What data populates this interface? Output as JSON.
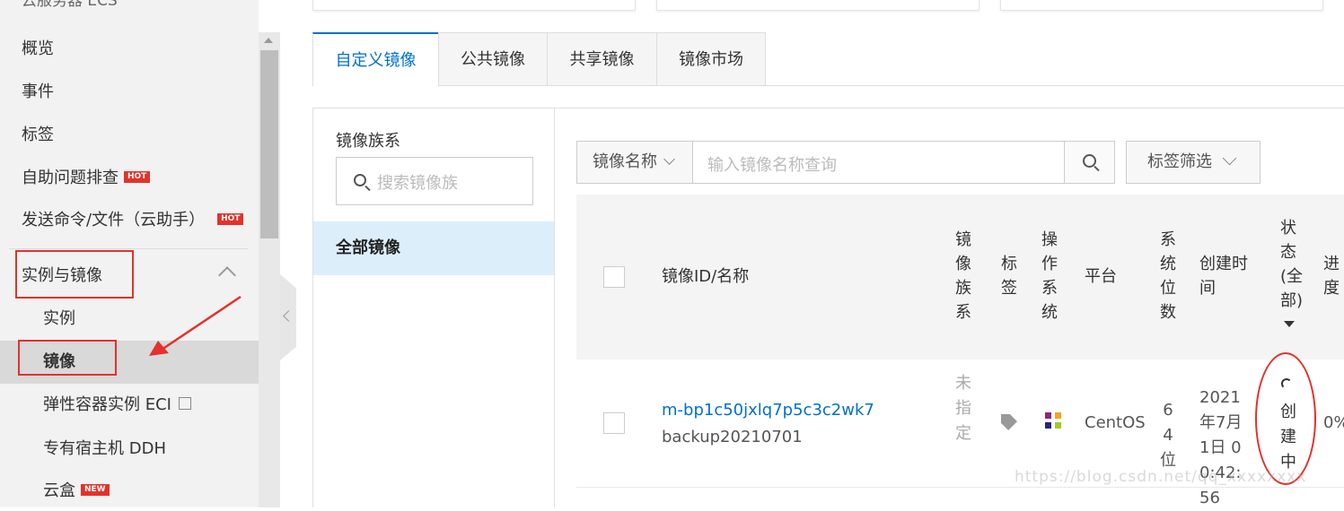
{
  "sidebar": {
    "title": "云服务器 ECS",
    "items": [
      {
        "label": "概览"
      },
      {
        "label": "事件"
      },
      {
        "label": "标签"
      },
      {
        "label": "自助问题排查",
        "badge": "HOT"
      },
      {
        "label": "发送命令/文件（云助手）",
        "badge": "HOT"
      }
    ],
    "group": {
      "label": "实例与镜像",
      "expanded": true
    },
    "sub_items": [
      {
        "label": "实例"
      },
      {
        "label": "镜像",
        "active": true
      },
      {
        "label": "弹性容器实例 ECI",
        "external": true
      },
      {
        "label": "专有宿主机 DDH"
      },
      {
        "label": "云盒",
        "badge": "NEW"
      }
    ]
  },
  "tabs": [
    {
      "label": "自定义镜像",
      "active": true
    },
    {
      "label": "公共镜像"
    },
    {
      "label": "共享镜像"
    },
    {
      "label": "镜像市场"
    }
  ],
  "family": {
    "title": "镜像族系",
    "search_placeholder": "搜索镜像族",
    "all_label": "全部镜像"
  },
  "filter": {
    "select_value": "镜像名称",
    "input_placeholder": "输入镜像名称查询",
    "tag_filter_label": "标签筛选"
  },
  "table": {
    "headers": {
      "id_name": "镜像ID/名称",
      "family": "镜像族系",
      "tags": "标签",
      "os": "操作系统",
      "platform": "平台",
      "bits": "系统位数",
      "created": "创建时间",
      "status": "状态(全部)",
      "progress": "进度"
    },
    "rows": [
      {
        "id": "m-bp1c50jxlq7p5c3c2wk7",
        "name": "backup20210701",
        "family": "未指定",
        "platform": "CentOS",
        "bits": "64位",
        "created": "2021年7月1日 00:42:56",
        "status": "创建中",
        "progress": "0%"
      }
    ]
  },
  "watermark": "https://blog.csdn.net/qq_xxxxxxxx",
  "colors": {
    "accent": "#0070cc",
    "hot_badge": "#e4312b",
    "annotation": "#e4312b"
  }
}
